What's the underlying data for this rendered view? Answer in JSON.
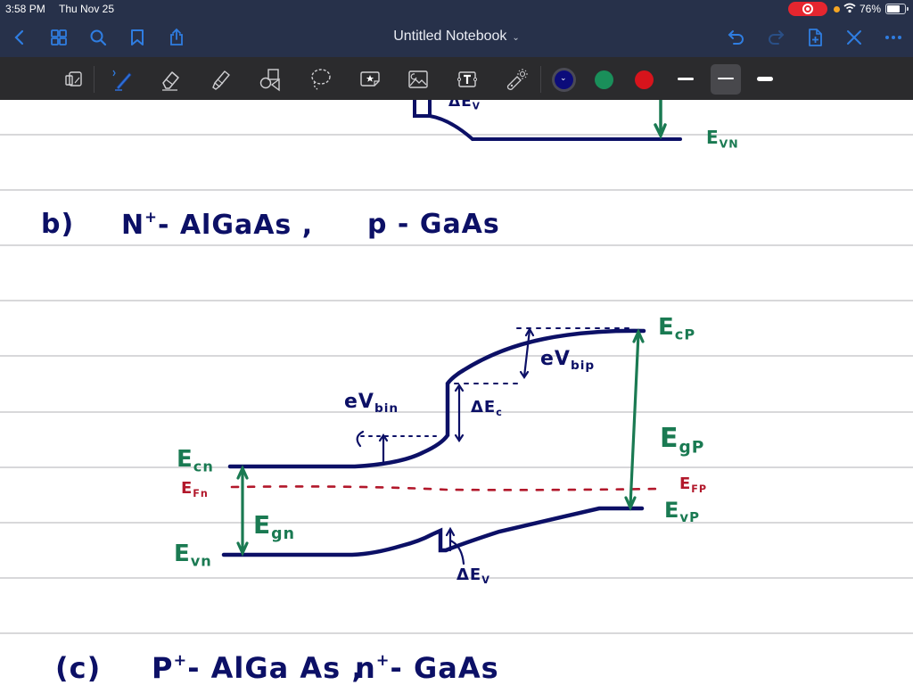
{
  "status_bar": {
    "time": "3:58 PM",
    "date": "Thu Nov 25",
    "recording_indicator": "screen-recording",
    "battery_percent": "76%",
    "battery_level": 0.76
  },
  "nav_bar": {
    "title": "Untitled Notebook",
    "title_dropdown_icon": "chevron-down",
    "left_icons": [
      "back-chevron",
      "grid-view",
      "search",
      "bookmark",
      "share"
    ],
    "right_icons": [
      "undo",
      "redo",
      "add-page",
      "close-x",
      "more-ellipsis"
    ]
  },
  "toolbar": {
    "tools": [
      "read-only-view",
      "pen",
      "eraser",
      "highlighter",
      "shapes",
      "lasso",
      "sticker",
      "image",
      "text-box",
      "laser-pointer"
    ],
    "active_tool": "pen",
    "pen_bluetooth_badge": "bluetooth",
    "colors": [
      {
        "name": "navy",
        "hex": "#0c0c7a",
        "selected": true
      },
      {
        "name": "green",
        "hex": "#1a8f5a",
        "selected": false
      },
      {
        "name": "red",
        "hex": "#d7141c",
        "selected": false
      }
    ],
    "stroke_widths": [
      {
        "name": "thin",
        "selected": false
      },
      {
        "name": "medium",
        "selected": true
      },
      {
        "name": "thick",
        "selected": false
      }
    ]
  },
  "page": {
    "ink_colors": {
      "navy": "#0c1066",
      "green": "#1a7a52",
      "red": "#b2182b"
    },
    "top_fragment": {
      "label_dEv": "ΔE",
      "label_dEv_sub": "V",
      "label_evn": "E",
      "label_evn_sub": "VN"
    },
    "heading_b": {
      "marker": "b)",
      "n_layer": "N",
      "n_sup": "+",
      "n_material": "- AlGaAs ,",
      "p_layer": "p - GaAs"
    },
    "diagram_b_labels": {
      "ecn": {
        "main": "E",
        "sub": "cn"
      },
      "efn": {
        "main": "E",
        "sub": "Fn"
      },
      "egn": {
        "main": "E",
        "sub": "gn"
      },
      "evn": {
        "main": "E",
        "sub": "vn"
      },
      "evbin": {
        "main": "eV",
        "sub": "bin"
      },
      "dec": {
        "main": "ΔE",
        "sub": "c"
      },
      "evbip": {
        "main": "eV",
        "sub": "bip"
      },
      "ecp": {
        "main": "E",
        "sub": "cP"
      },
      "egp": {
        "main": "E",
        "sub": "gP"
      },
      "efp": {
        "main": "E",
        "sub": "FP"
      },
      "evp": {
        "main": "E",
        "sub": "vP"
      },
      "dev": {
        "main": "ΔE",
        "sub": "V"
      }
    },
    "heading_c": {
      "marker": "(c)",
      "p_layer": "P",
      "p_sup": "+",
      "p_material": "- AlGa As ,",
      "n_layer": "n",
      "n_sup": "+",
      "n_material": "- GaAs"
    }
  }
}
